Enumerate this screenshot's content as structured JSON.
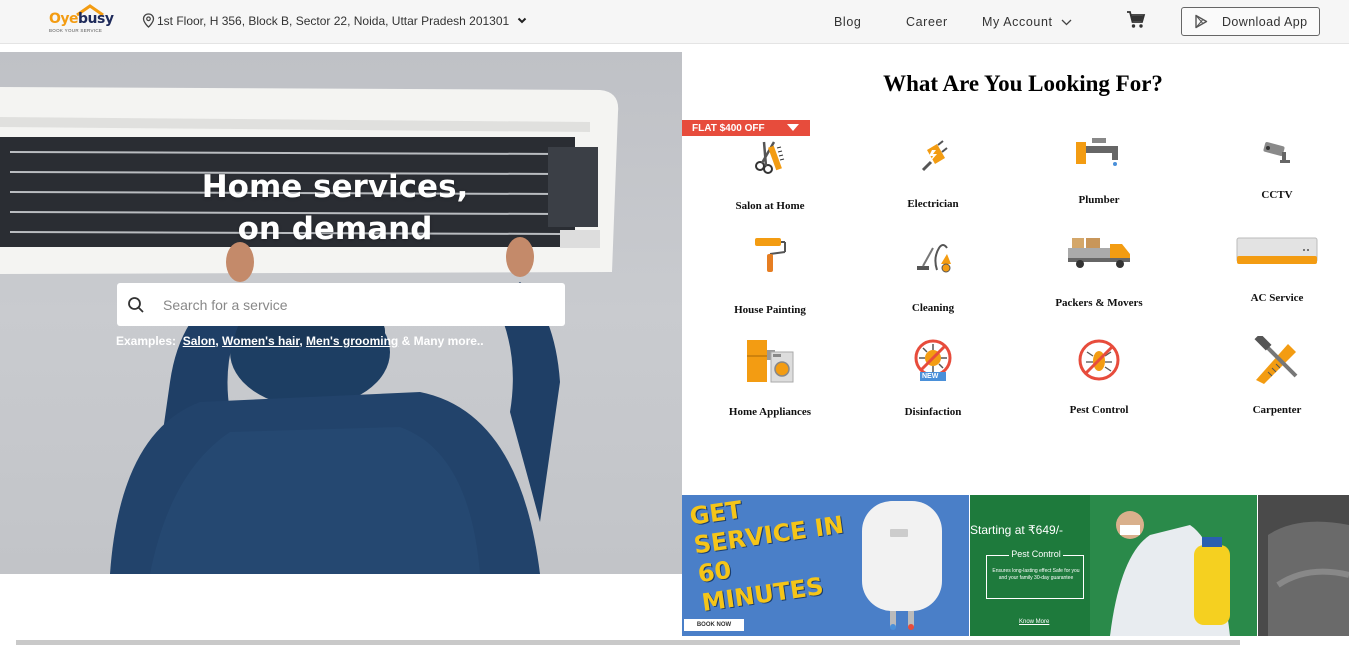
{
  "header": {
    "logo": {
      "brand_part1": "Oye",
      "brand_part2": "busy",
      "tagline": "BOOK YOUR SERVICE"
    },
    "location": "1st Floor, H 356, Block B, Sector 22, Noida, Uttar Pradesh 201301",
    "nav": {
      "blog": "Blog",
      "career": "Career",
      "account": "My Account"
    },
    "download_app": "Download App",
    "icons": {
      "location": "location-pin-icon",
      "cart": "cart-icon",
      "play": "play-store-icon"
    }
  },
  "hero": {
    "title_line1": "Home services,",
    "title_line2": "on demand",
    "search": {
      "placeholder": "Search for a service",
      "value": ""
    },
    "examples": {
      "prefix": "Examples:",
      "links": [
        "Salon",
        "Women's hair",
        "Men's grooming"
      ],
      "suffix": "& Many more.."
    }
  },
  "services_section": {
    "title": "What Are You Looking For?",
    "offer_badge": "FLAT $400 OFF",
    "items": [
      {
        "label": "Salon at Home",
        "icon": "scissors-comb-icon"
      },
      {
        "label": "Electrician",
        "icon": "plug-icon"
      },
      {
        "label": "Plumber",
        "icon": "tap-icon"
      },
      {
        "label": "CCTV",
        "icon": "cctv-camera-icon"
      },
      {
        "label": "House Painting",
        "icon": "paint-roller-icon"
      },
      {
        "label": "Cleaning",
        "icon": "vacuum-cleaner-icon"
      },
      {
        "label": "Packers & Movers",
        "icon": "moving-truck-icon"
      },
      {
        "label": "AC Service",
        "icon": "air-conditioner-icon"
      },
      {
        "label": "Home Appliances",
        "icon": "appliances-icon"
      },
      {
        "label": "Disinfaction",
        "icon": "virus-new-icon",
        "badge": "NEW"
      },
      {
        "label": "Pest Control",
        "icon": "no-cockroach-icon"
      },
      {
        "label": "Carpenter",
        "icon": "hammer-saw-icon"
      }
    ]
  },
  "banners": {
    "geyser": {
      "headline": "GET SERVICE IN 60 MINUTES",
      "cta": "BOOK NOW"
    },
    "pest": {
      "price": "Starting at ₹649/-",
      "title": "Pest Control",
      "desc": "Ensures long-lasting effect Safe for you and your family 30-day guarantee",
      "cta": "Know More"
    }
  },
  "colors": {
    "accent_orange": "#f39c12",
    "offer_red": "#e74c3c",
    "brand_navy": "#1e2a5a"
  }
}
